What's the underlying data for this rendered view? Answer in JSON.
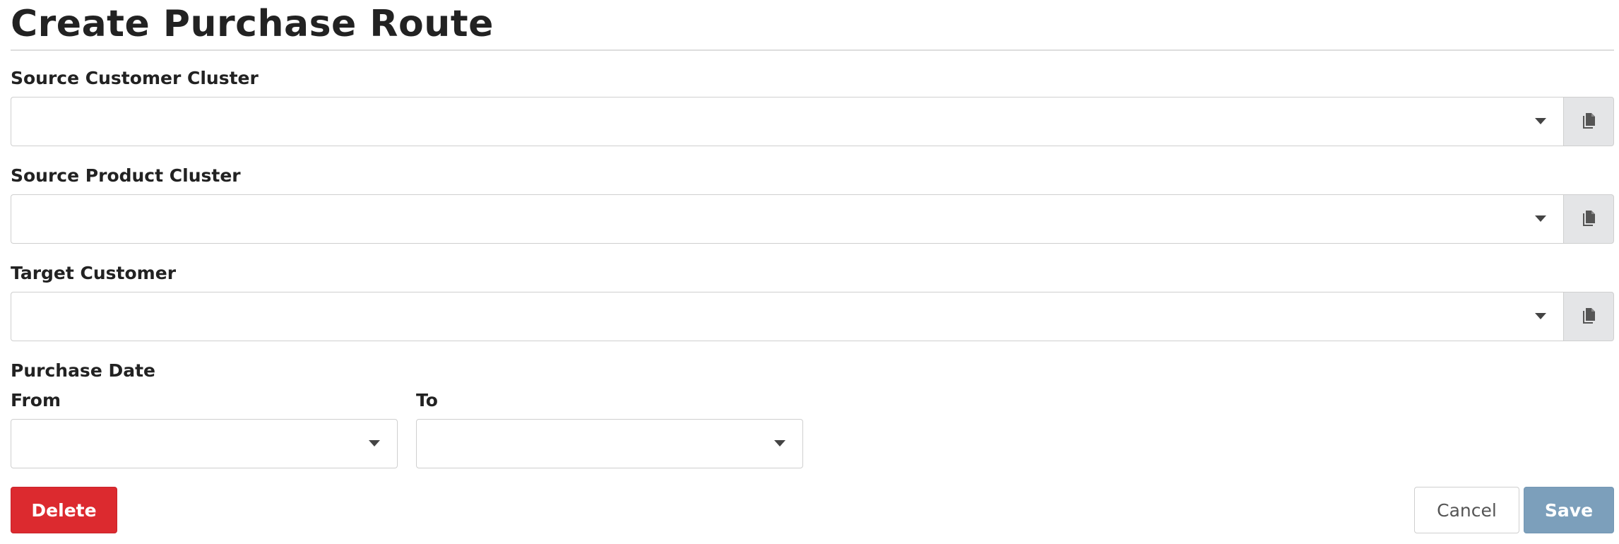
{
  "page": {
    "title": "Create Purchase Route"
  },
  "form": {
    "source_customer_cluster": {
      "label": "Source Customer Cluster",
      "value": "",
      "action_icon": "copy-icon"
    },
    "source_product_cluster": {
      "label": "Source Product Cluster",
      "value": "",
      "action_icon": "copy-icon"
    },
    "target_customer": {
      "label": "Target Customer",
      "value": "",
      "action_icon": "copy-icon"
    },
    "purchase_date": {
      "label": "Purchase Date",
      "from": {
        "label": "From",
        "value": ""
      },
      "to": {
        "label": "To",
        "value": ""
      }
    }
  },
  "actions": {
    "delete_label": "Delete",
    "cancel_label": "Cancel",
    "save_label": "Save"
  },
  "colors": {
    "delete": "#dc2a2f",
    "save": "#7c9fbb",
    "addon_bg": "#e4e5e7",
    "border": "#cfcfcf",
    "text": "#222222"
  }
}
